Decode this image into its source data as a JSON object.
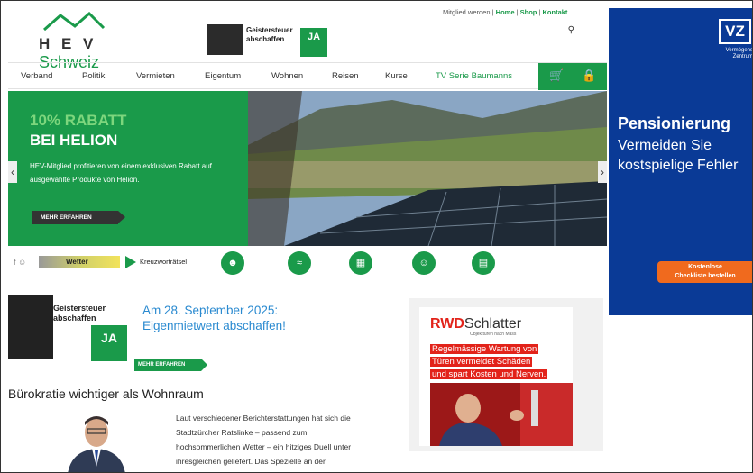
{
  "header": {
    "brand_letters": "H E V",
    "brand_sub": "Schweiz",
    "top_links": [
      "Mitglied werden",
      "Home",
      "Shop",
      "Kontakt"
    ],
    "banner_text": "Geistersteuer abschaffen",
    "banner_ja": "JA"
  },
  "nav": {
    "items": [
      "Verband",
      "Politik",
      "Vermieten",
      "Eigentum",
      "Wohnen",
      "Reisen",
      "Kurse",
      "TV Serie Baumanns"
    ]
  },
  "hero": {
    "headline_1": "10% RABATT",
    "headline_2": "BEI HELION",
    "description": "HEV-Mitglied profitieren von einem exklusiven Rabatt auf ausgewählte Produkte von Helion.",
    "button": "MEHR ERFAHREN"
  },
  "iconrow": {
    "social": "f ☺",
    "wetter": "Wetter",
    "kreuz": "Kreuzworträtsel"
  },
  "teaser": {
    "banner_text": "Geistersteuer abschaffen",
    "banner_ja": "JA",
    "headline_1": "Am 28. September 2025:",
    "headline_2": "Eigenmietwert abschaffen!",
    "button": "MEHR ERFAHREN"
  },
  "article": {
    "title": "Bürokratie wichtiger als Wohnraum",
    "body": "Laut verschiedener Berichterstattungen hat sich die Stadtzürcher Ratslinke – passend zum hochsommerlichen Wetter – ein hitziges Duell unter ihresgleichen geliefert. Das Spezielle an der «internen»…"
  },
  "rwd_ad": {
    "logo_red": "RWD",
    "logo_dark": "Schlatter",
    "tagline": "Objekttüren nach Mass",
    "line_1": "Regelmässige Wartung von",
    "line_2": "Türen vermeidet Schäden",
    "line_3": "und spart Kosten und Nerven."
  },
  "side_ad": {
    "logo": "VZ",
    "logo_sub": "Vermögens Zentrum",
    "headline": "Pensionierung",
    "sub_1": "Vermeiden Sie",
    "sub_2": "kostspielige Fehler",
    "cta_1": "Kostenlose",
    "cta_2": "Checkliste bestellen"
  },
  "colors": {
    "brand_green": "#1a9a4a",
    "side_blue": "#0a3a96",
    "cta_orange": "#f06a1e",
    "rwd_red": "#e2231a"
  }
}
